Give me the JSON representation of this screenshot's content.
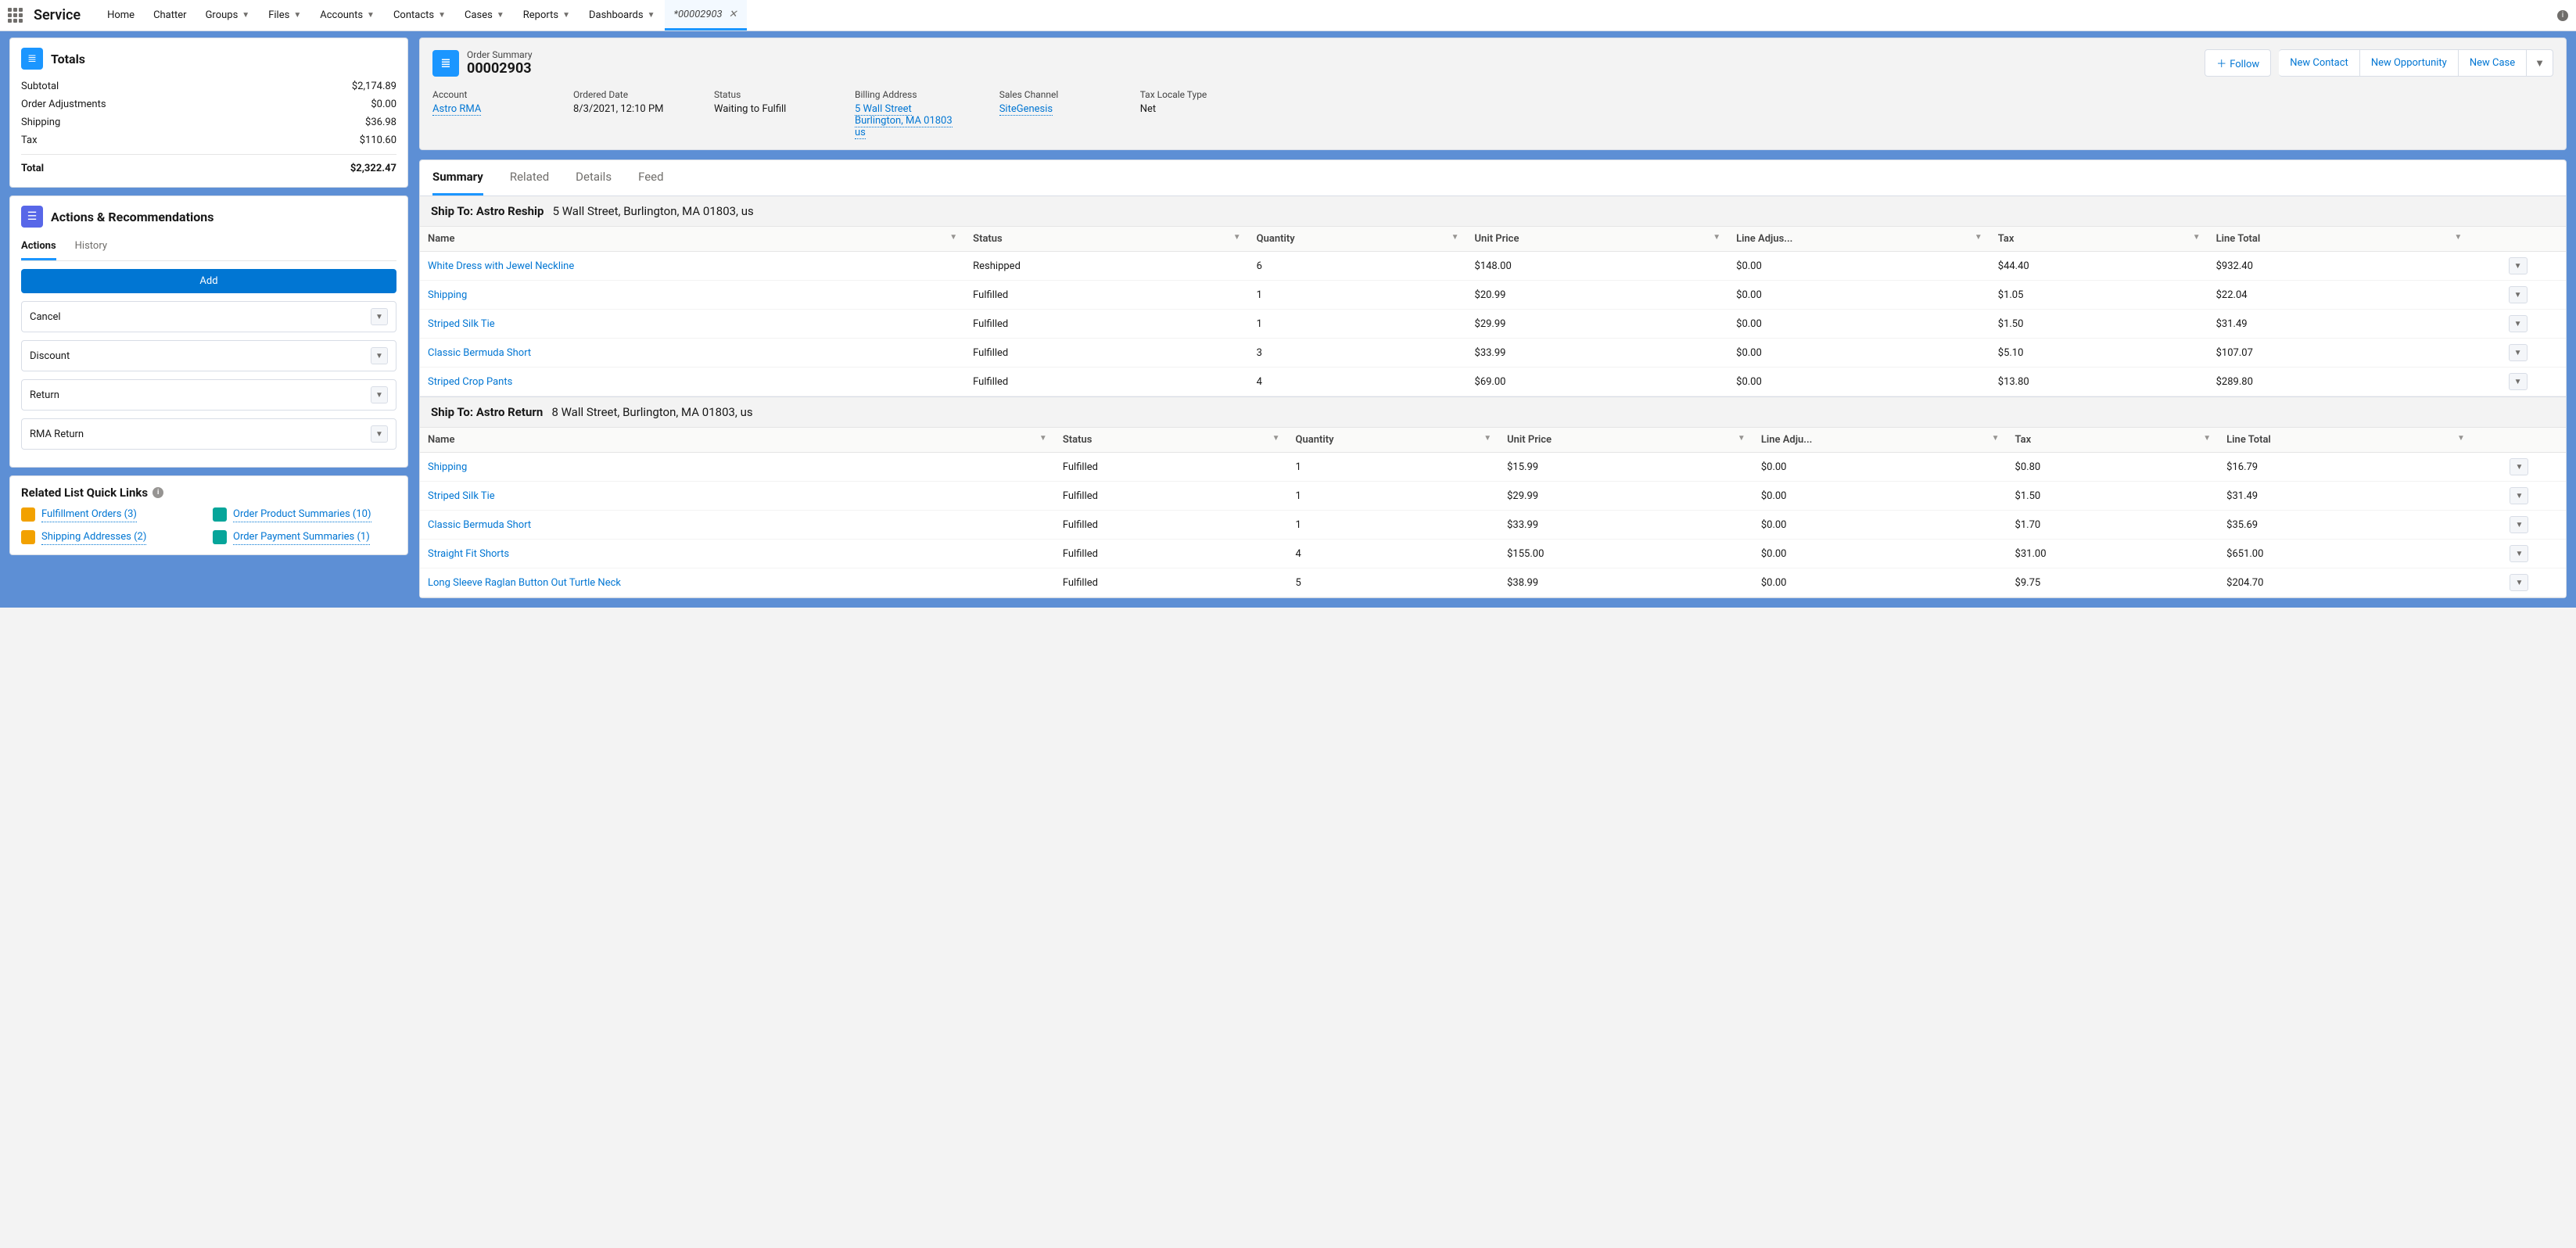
{
  "app": {
    "name": "Service"
  },
  "nav": {
    "items": [
      "Home",
      "Chatter",
      "Groups",
      "Files",
      "Accounts",
      "Contacts",
      "Cases",
      "Reports",
      "Dashboards"
    ],
    "active_tab": {
      "label": "00002903",
      "prefix": "* "
    }
  },
  "totals": {
    "title": "Totals",
    "rows": [
      {
        "label": "Subtotal",
        "value": "$2,174.89"
      },
      {
        "label": "Order Adjustments",
        "value": "$0.00"
      },
      {
        "label": "Shipping",
        "value": "$36.98"
      },
      {
        "label": "Tax",
        "value": "$110.60"
      }
    ],
    "total_label": "Total",
    "total_value": "$2,322.47"
  },
  "actions": {
    "title": "Actions & Recommendations",
    "tabs": [
      "Actions",
      "History"
    ],
    "add": "Add",
    "combos": [
      "Cancel",
      "Discount",
      "Return",
      "RMA Return"
    ]
  },
  "quicklinks": {
    "title": "Related List Quick Links",
    "items": [
      {
        "label": "Fulfillment Orders (3)",
        "color": "#f2a100"
      },
      {
        "label": "Order Product Summaries (10)",
        "color": "#06a59a"
      },
      {
        "label": "Shipping Addresses (2)",
        "color": "#f2a100"
      },
      {
        "label": "Order Payment Summaries (1)",
        "color": "#06a59a"
      }
    ]
  },
  "record": {
    "entity": "Order Summary",
    "number": "00002903",
    "buttons": {
      "follow": "Follow",
      "newContact": "New Contact",
      "newOpportunity": "New Opportunity",
      "newCase": "New Case"
    },
    "fields": {
      "account": {
        "label": "Account",
        "value": "Astro RMA"
      },
      "ordered": {
        "label": "Ordered Date",
        "value": "8/3/2021, 12:10 PM"
      },
      "status": {
        "label": "Status",
        "value": "Waiting to Fulfill"
      },
      "billing": {
        "label": "Billing Address",
        "l1": "5 Wall Street",
        "l2": "Burlington, MA 01803",
        "l3": "us"
      },
      "channel": {
        "label": "Sales Channel",
        "value": "SiteGenesis"
      },
      "taxlocale": {
        "label": "Tax Locale Type",
        "value": "Net"
      }
    },
    "tabs": [
      "Summary",
      "Related",
      "Details",
      "Feed"
    ]
  },
  "cols": {
    "name": "Name",
    "status": "Status",
    "qty": "Quantity",
    "unit": "Unit Price",
    "adj": "Line Adjus...",
    "adj2": "Line Adju...",
    "tax": "Tax",
    "total": "Line Total"
  },
  "ship1": {
    "prefix": "Ship To: ",
    "name": "Astro Reship",
    "addr": "5 Wall Street, Burlington, MA  01803, us",
    "rows": [
      {
        "n": "White Dress with Jewel Neckline",
        "s": "Reshipped",
        "q": "6",
        "u": "$148.00",
        "a": "$0.00",
        "t": "$44.40",
        "lt": "$932.40"
      },
      {
        "n": "Shipping",
        "s": "Fulfilled",
        "q": "1",
        "u": "$20.99",
        "a": "$0.00",
        "t": "$1.05",
        "lt": "$22.04"
      },
      {
        "n": "Striped Silk Tie",
        "s": "Fulfilled",
        "q": "1",
        "u": "$29.99",
        "a": "$0.00",
        "t": "$1.50",
        "lt": "$31.49"
      },
      {
        "n": "Classic Bermuda Short",
        "s": "Fulfilled",
        "q": "3",
        "u": "$33.99",
        "a": "$0.00",
        "t": "$5.10",
        "lt": "$107.07"
      },
      {
        "n": "Striped Crop Pants",
        "s": "Fulfilled",
        "q": "4",
        "u": "$69.00",
        "a": "$0.00",
        "t": "$13.80",
        "lt": "$289.80"
      }
    ]
  },
  "ship2": {
    "prefix": "Ship To: ",
    "name": "Astro Return",
    "addr": "8 Wall Street, Burlington, MA  01803, us",
    "rows": [
      {
        "n": "Shipping",
        "s": "Fulfilled",
        "q": "1",
        "u": "$15.99",
        "a": "$0.00",
        "t": "$0.80",
        "lt": "$16.79"
      },
      {
        "n": "Striped Silk Tie",
        "s": "Fulfilled",
        "q": "1",
        "u": "$29.99",
        "a": "$0.00",
        "t": "$1.50",
        "lt": "$31.49"
      },
      {
        "n": "Classic Bermuda Short",
        "s": "Fulfilled",
        "q": "1",
        "u": "$33.99",
        "a": "$0.00",
        "t": "$1.70",
        "lt": "$35.69"
      },
      {
        "n": "Straight Fit Shorts",
        "s": "Fulfilled",
        "q": "4",
        "u": "$155.00",
        "a": "$0.00",
        "t": "$31.00",
        "lt": "$651.00"
      },
      {
        "n": "Long Sleeve Raglan Button Out Turtle Neck",
        "s": "Fulfilled",
        "q": "5",
        "u": "$38.99",
        "a": "$0.00",
        "t": "$9.75",
        "lt": "$204.70"
      }
    ]
  }
}
